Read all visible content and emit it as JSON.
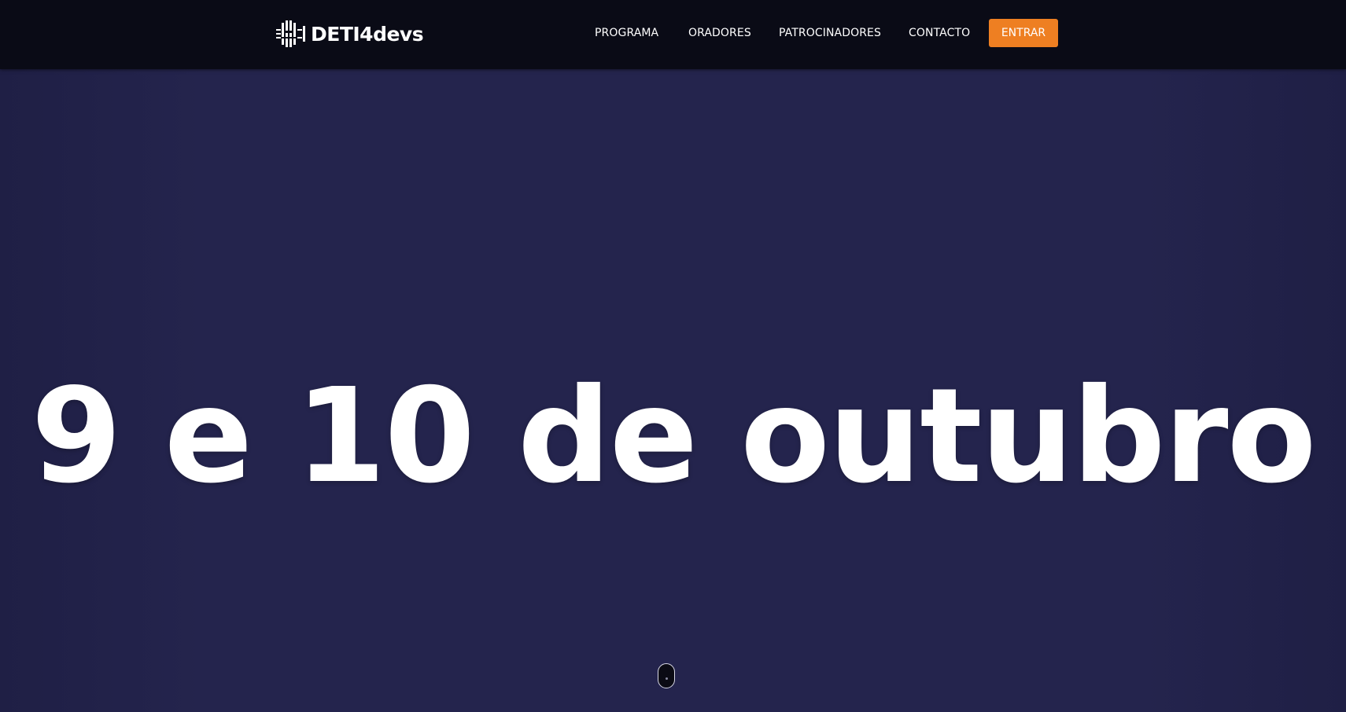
{
  "brand": {
    "logo_text": "DETI4devs"
  },
  "nav": {
    "items": [
      {
        "label": "PROGRAMA"
      },
      {
        "label": "ORADORES"
      },
      {
        "label": "PATROCINADORES"
      },
      {
        "label": "CONTACTO"
      }
    ],
    "cta_label": "ENTRAR"
  },
  "hero": {
    "title": "9 e 10 de outubro"
  },
  "colors": {
    "navbar_bg": "#0a0b16",
    "hero_bg": "#24244d",
    "accent": "#ee7f22",
    "text": "#ffffff"
  },
  "icons": {
    "logo_mark": "circuit-chip-icon",
    "scroll": "mouse-scroll-icon"
  }
}
